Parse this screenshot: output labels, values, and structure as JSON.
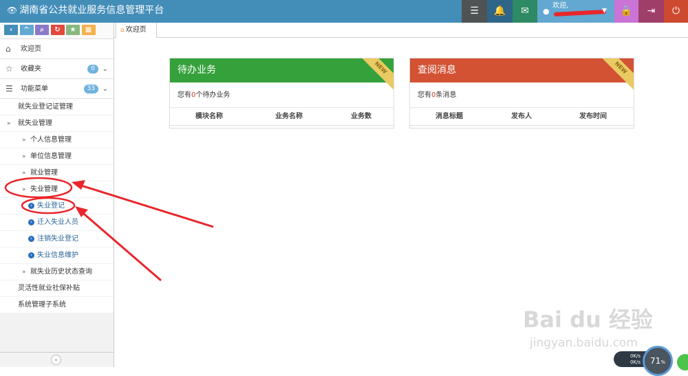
{
  "header": {
    "title": "湖南省公共就业服务信息管理平台",
    "user_welcome": "欢迎,"
  },
  "sidebar": {
    "shortcut_icons": [
      "back-icon",
      "up-icon",
      "search-icon",
      "refresh-icon",
      "star-icon",
      "grid-icon"
    ],
    "top_items": [
      {
        "label": "欢迎页",
        "icon": "home-icon"
      },
      {
        "label": "收藏夹",
        "icon": "star-outline-icon",
        "badge": "0"
      },
      {
        "label": "功能菜单",
        "icon": "list-icon",
        "badge": "33"
      }
    ],
    "menu": [
      {
        "label": "就失业登记证管理"
      },
      {
        "label": "就失业管理"
      },
      {
        "label": "个人信息管理"
      },
      {
        "label": "单位信息管理"
      },
      {
        "label": "就业管理"
      },
      {
        "label": "失业管理"
      },
      {
        "label": "失业登记"
      },
      {
        "label": "迁入失业人员"
      },
      {
        "label": "注销失业登记"
      },
      {
        "label": "失业信息维护"
      },
      {
        "label": "就失业历史状态查询"
      },
      {
        "label": "灵活性就业社保补贴"
      },
      {
        "label": "系统管理子系统"
      }
    ]
  },
  "tabs": [
    {
      "label": "欢迎页"
    }
  ],
  "widgets": {
    "pending": {
      "title": "待办业务",
      "ribbon": "NEW",
      "text_prefix": "您有",
      "count": "0",
      "text_suffix": "个待办业务",
      "columns": [
        "模块名称",
        "业务名称",
        "业务数"
      ]
    },
    "messages": {
      "title": "查阅消息",
      "ribbon": "NEW",
      "text_prefix": "您有",
      "count": "0",
      "text_suffix": "条消息",
      "columns": [
        "消息标题",
        "发布人",
        "发布时间"
      ]
    }
  },
  "watermark": {
    "brand": "Bai du 经验",
    "url": "jingyan.baidu.com"
  },
  "system_widget": {
    "net_up": "0K/s",
    "net_down": "0K/s",
    "cpu": "71",
    "unit": "%"
  },
  "colors": {
    "header": "#438eb9",
    "pending": "#35a13b",
    "messages": "#d35234",
    "annotation": "#e8262b"
  }
}
